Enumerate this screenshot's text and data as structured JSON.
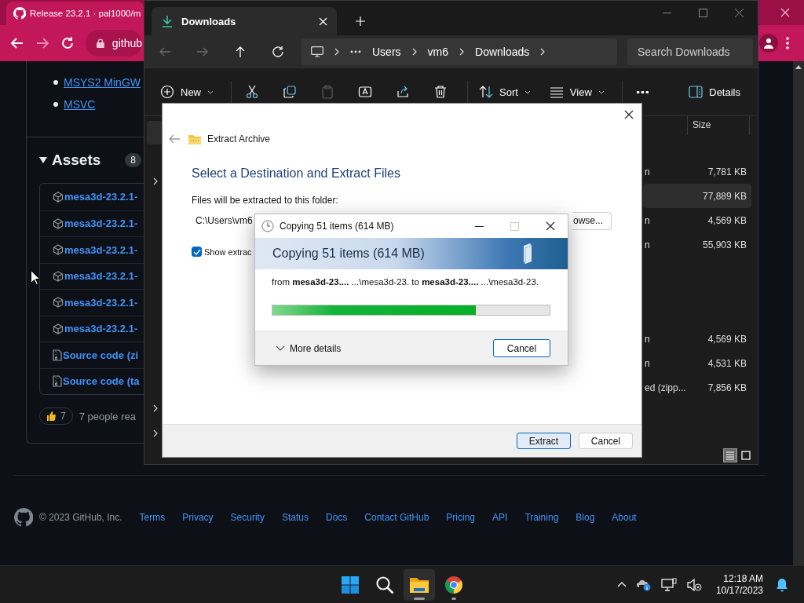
{
  "browser": {
    "tab": {
      "title": "Release 23.2.1 · pal1000/m"
    },
    "nav": [
      {
        "kind": "back",
        "disabled": false
      },
      {
        "kind": "forward",
        "disabled": true
      },
      {
        "kind": "reload",
        "disabled": false
      }
    ],
    "address": "github",
    "page": {
      "links": [
        {
          "text": "MSYS2 MinGW"
        },
        {
          "text": "MSVC"
        }
      ],
      "assets": {
        "title": "Assets",
        "count": "8",
        "expanded": true,
        "items": [
          {
            "kind": "package",
            "label": "mesa3d-23.2.1-"
          },
          {
            "kind": "package",
            "label": "mesa3d-23.2.1-"
          },
          {
            "kind": "package",
            "label": "mesa3d-23.2.1-"
          },
          {
            "kind": "package",
            "label": "mesa3d-23.2.1-"
          },
          {
            "kind": "package",
            "label": "mesa3d-23.2.1-"
          },
          {
            "kind": "package",
            "label": "mesa3d-23.2.1-"
          },
          {
            "kind": "source",
            "label": "Source code (zi"
          },
          {
            "kind": "source",
            "label": "Source code (ta"
          }
        ]
      },
      "reaction": {
        "count": "7",
        "summary": "7 people rea"
      }
    },
    "footer": {
      "copyright": "© 2023 GitHub, Inc.",
      "links": [
        "Terms",
        "Privacy",
        "Security",
        "Status",
        "Docs",
        "Contact GitHub",
        "Pricing",
        "API",
        "Training",
        "Blog",
        "About"
      ]
    }
  },
  "explorer": {
    "tab": {
      "title": "Downloads"
    },
    "nav": [
      {
        "kind": "back",
        "disabled": true
      },
      {
        "kind": "forward",
        "disabled": true
      },
      {
        "kind": "up",
        "disabled": false
      },
      {
        "kind": "refresh",
        "disabled": false
      }
    ],
    "breadcrumb": [
      "Users",
      "vm6",
      "Downloads"
    ],
    "search": {
      "placeholder": "Search Downloads"
    },
    "toolbar": [
      {
        "kind": "new",
        "label": "New",
        "disabled": false
      },
      {
        "kind": "cut",
        "disabled": false
      },
      {
        "kind": "copy",
        "disabled": false
      },
      {
        "kind": "paste",
        "disabled": true
      },
      {
        "kind": "rename",
        "disabled": false
      },
      {
        "kind": "share",
        "disabled": false
      },
      {
        "kind": "delete",
        "disabled": false
      },
      {
        "kind": "sort",
        "label": "Sort",
        "disabled": false
      },
      {
        "kind": "view",
        "label": "View",
        "disabled": false
      },
      {
        "kind": "more",
        "disabled": false
      }
    ],
    "details": {
      "label": "Details"
    },
    "size_column": "Size",
    "groups": [
      [
        {
          "type": "n",
          "size": "7,781 KB",
          "selected": false
        },
        {
          "size": "77,889 KB",
          "selected": true
        },
        {
          "type": "n",
          "size": "4,569 KB",
          "selected": false
        },
        {
          "type": "n",
          "size": "55,903 KB",
          "selected": false
        }
      ],
      [
        {
          "type": "n",
          "size": "4,569 KB",
          "selected": false
        },
        {
          "type": "n",
          "size": "4,531 KB",
          "selected": false
        },
        {
          "type": "ed (zipp...",
          "size": "7,856 KB",
          "selected": false
        }
      ]
    ],
    "view_modes": [
      {
        "kind": "details",
        "selected": true
      },
      {
        "kind": "tiles",
        "selected": false
      }
    ]
  },
  "extract_dialog": {
    "title": "Extract Archive",
    "heading": "Select a Destination and Extract Files",
    "folder_label": "Files will be extracted to this folder:",
    "path": "C:\\Users\\vm6",
    "browse": "owse...",
    "show_files": {
      "label": "Show extrac",
      "checked": true
    },
    "buttons": [
      {
        "label": "Extract",
        "default": true
      },
      {
        "label": "Cancel",
        "default": false
      }
    ]
  },
  "copy_dialog": {
    "title": "Copying 51 items (614 MB)",
    "header": "Copying 51 items (614 MB)",
    "detail": "from **mesa3d-23....** ...\\mesa3d-23. to **mesa3d-23....** ...\\mesa3d-23.",
    "progress": {
      "level": 0.735
    },
    "more_details": {
      "label": "More details",
      "expanded": false
    },
    "cancel": "Cancel"
  },
  "taskbar": {
    "apps": [
      {
        "kind": "start",
        "running": false,
        "active": false
      },
      {
        "kind": "search",
        "running": false,
        "active": false
      },
      {
        "kind": "files",
        "running": true,
        "active": true
      },
      {
        "kind": "browser",
        "running": true,
        "active": false
      }
    ],
    "time": "12:18 AM",
    "date": "10/17/2023"
  }
}
